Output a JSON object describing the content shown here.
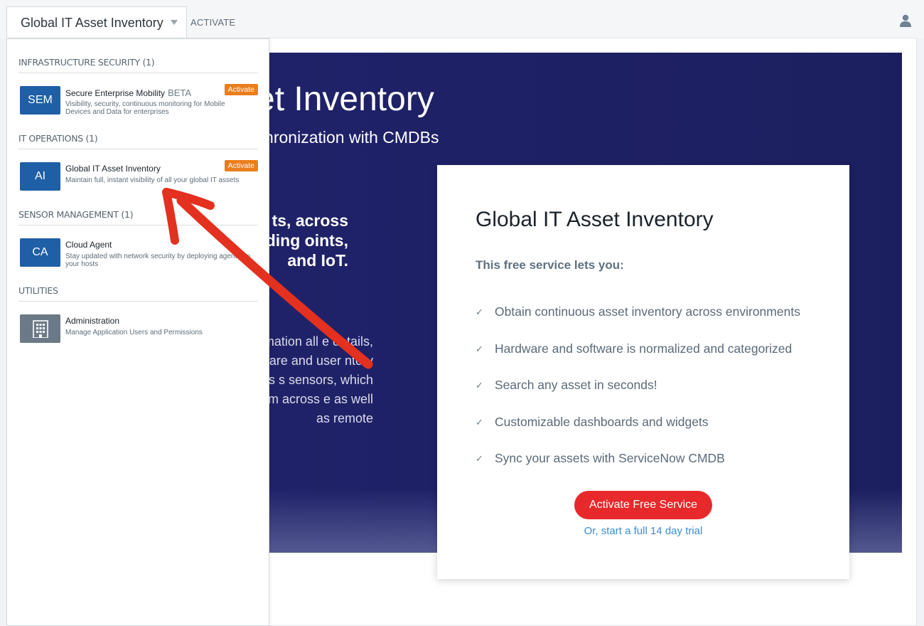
{
  "header": {
    "module_name": "Global IT Asset Inventory",
    "activate_label": "ACTIVATE",
    "user_icon": "user-icon"
  },
  "hero": {
    "title": "Asset Inventory",
    "subtitle": "and synchronization with CMDBs",
    "bold_text": "of both, ts, across ncluding oints, and IoT.",
    "body_text": "information all e details, running ware and user ntory collection is s sensors, which e data from across e as well as remote"
  },
  "card": {
    "title": "Global IT Asset Inventory",
    "lead": "This free service lets you:",
    "benefits": [
      "Obtain continuous asset inventory across environments",
      "Hardware and software is normalized and categorized",
      "Search any asset in seconds!",
      "Customizable dashboards and widgets",
      "Sync your assets with ServiceNow CMDB"
    ],
    "cta_label": "Activate Free Service",
    "trial_label": "Or, start a full 14 day trial"
  },
  "menu": {
    "sections": [
      {
        "heading": "INFRASTRUCTURE SECURITY (1)"
      },
      {
        "heading": "IT OPERATIONS (1)"
      },
      {
        "heading": "SENSOR MANAGEMENT (1)"
      },
      {
        "heading": "UTILITIES"
      }
    ],
    "items": [
      {
        "tile": "SEM",
        "title": "Secure Enterprise Mobility",
        "tag": "BETA",
        "badge": "Activate",
        "desc": "Visibility, security, continuous monitoring for Mobile Devices and Data for enterprises"
      },
      {
        "tile": "AI",
        "title": "Global IT Asset Inventory",
        "badge": "Activate",
        "desc": "Maintain full, instant visibility of all your global IT assets"
      },
      {
        "tile": "CA",
        "title": "Cloud Agent",
        "desc": "Stay updated with network security by deploying agents on your hosts"
      },
      {
        "tile_icon": "building-icon",
        "title": "Administration",
        "desc": "Manage Application Users and Permissions"
      }
    ]
  },
  "colors": {
    "tile_blue": "#1f5fa5",
    "badge_orange": "#ea7e1d",
    "cta_red": "#e8292b",
    "hero_navy": "#1c1f5f",
    "annotation_red": "#e3301f"
  }
}
